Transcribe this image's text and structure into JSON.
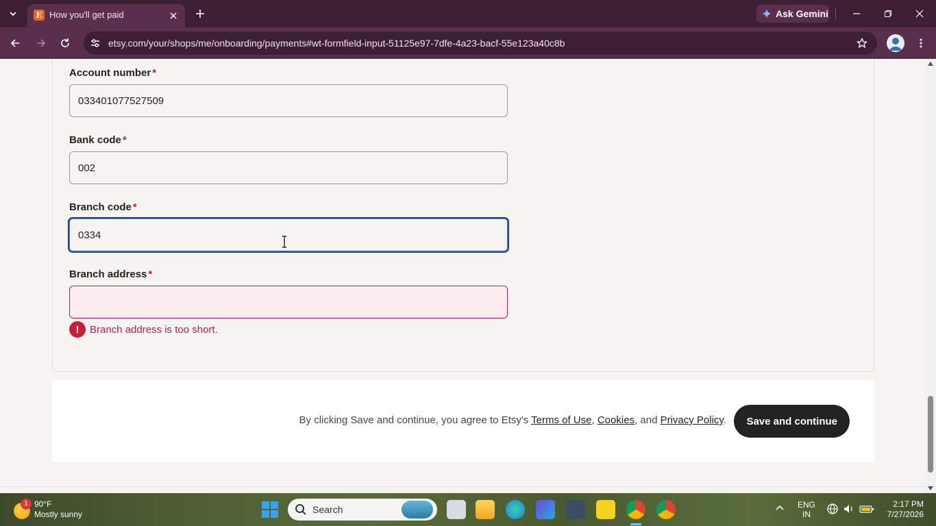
{
  "browser": {
    "tab_title": "How you'll get paid",
    "gemini_label": "Ask Gemini",
    "url": "etsy.com/your/shops/me/onboarding/payments#wt-formfield-input-51125e97-7dfe-4a23-bacf-55e123a40c8b"
  },
  "form": {
    "required_marker": "*",
    "account_number": {
      "label": "Account number",
      "value": "033401077527509"
    },
    "bank_code": {
      "label": "Bank code",
      "value": "002"
    },
    "branch_code": {
      "label": "Branch code",
      "value": "0334"
    },
    "branch_address": {
      "label": "Branch address",
      "value": "",
      "error": "Branch address is too short."
    },
    "error_icon_glyph": "!"
  },
  "footer": {
    "legal_prefix": "By clicking Save and continue, you agree to Etsy's ",
    "terms_link": "Terms of Use",
    "sep1": ", ",
    "cookies_link": "Cookies",
    "sep2": ", and ",
    "privacy_link": "Privacy Policy",
    "legal_suffix": ".",
    "save_button": "Save and continue"
  },
  "taskbar": {
    "weather_badge": "1",
    "weather_temp": "90°F",
    "weather_desc": "Mostly sunny",
    "search_placeholder": "Search",
    "lang_line1": "ENG",
    "lang_line2": "IN",
    "time": "2:17 PM",
    "date": "7/27/2026"
  },
  "colors": {
    "brand_accent": "#f1641e",
    "focus_border": "#3d63b5",
    "error": "#c41e3a",
    "button_bg": "#222222"
  }
}
